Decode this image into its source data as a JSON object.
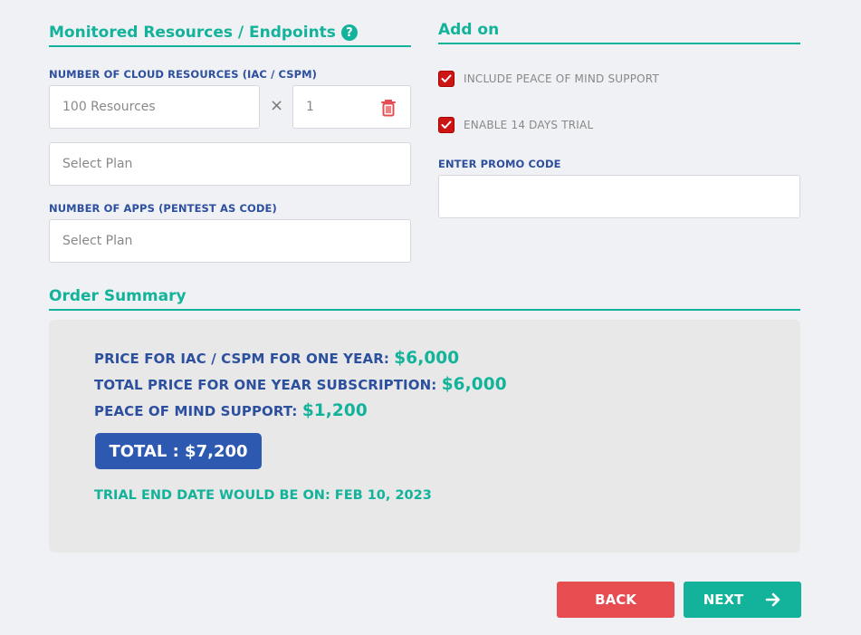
{
  "monitored": {
    "title": "Monitored Resources / Endpoints",
    "help_icon": "?",
    "cloud_label": "NUMBER OF CLOUD RESOURCES (IAC / CSPM)",
    "cloud_value": "100 Resources",
    "times_symbol": "×",
    "quantity_value": "1",
    "select_plan_1": "Select Plan",
    "apps_label": "NUMBER OF APPS (PENTEST AS CODE)",
    "select_plan_2": "Select Plan"
  },
  "addon": {
    "title": "Add on",
    "peace_of_mind_label": "INCLUDE PEACE OF MIND SUPPORT",
    "trial_label": "ENABLE 14 DAYS TRIAL",
    "promo_label": "ENTER PROMO CODE",
    "promo_value": ""
  },
  "summary": {
    "title": "Order Summary",
    "iac_label": "PRICE FOR IAC / CSPM FOR ONE YEAR:",
    "iac_value": "$6,000",
    "total_year_label": "TOTAL PRICE FOR ONE YEAR SUBSCRIPTION:",
    "total_year_value": "$6,000",
    "pom_label": "PEACE OF MIND SUPPORT:",
    "pom_value": "$1,200",
    "total": "TOTAL : $7,200",
    "trial_end": "TRIAL END DATE WOULD BE ON: FEB 10, 2023"
  },
  "actions": {
    "back": "BACK",
    "next": "NEXT"
  },
  "colors": {
    "accent": "#12b39a",
    "label_blue": "#2c4f9e",
    "danger": "#e64d51",
    "total_badge": "#2d59b0"
  },
  "icons": {
    "help": "question-circle-icon",
    "delete": "trash-icon",
    "checkbox": "checkmark-icon",
    "next": "arrow-right-icon"
  }
}
